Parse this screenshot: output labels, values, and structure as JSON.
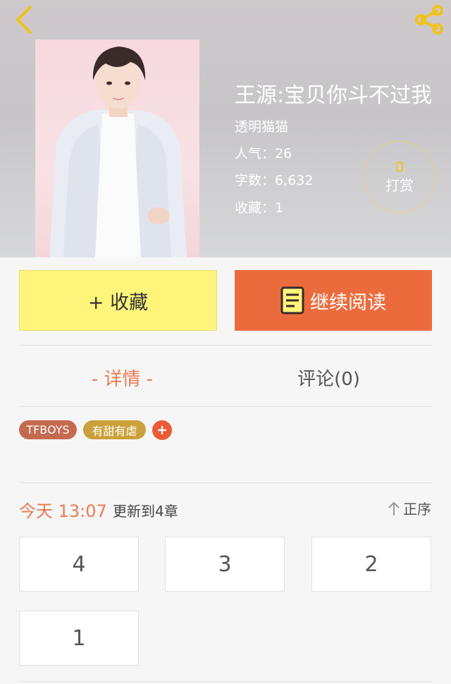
{
  "book": {
    "title": "王源:宝贝你斗不过我",
    "author": "透明猫猫",
    "popularity": "人气：26",
    "word_count": "字数：6,632",
    "favorites": "收藏：1",
    "reward_count": "0",
    "reward_label": "打赏"
  },
  "actions": {
    "favorite_label": "+ 收藏",
    "read_label": "继续阅读"
  },
  "tabs": [
    {
      "label": "- 详情 -",
      "active": true
    },
    {
      "label": "评论(0)",
      "active": false
    }
  ],
  "tags": [
    "TFBOYS",
    "有甜有虐"
  ],
  "update": {
    "time": "今天 13:07",
    "text": "更新到4章",
    "sort_label": "正序"
  },
  "chapters": [
    "4",
    "3",
    "2",
    "1"
  ],
  "colors": {
    "accent": "#ec6b3d",
    "favorite_button": "#fff57a",
    "tag_tfboys": "#c46a4f",
    "tag_sweet": "#caa13a",
    "reward_count": "#f0c419"
  },
  "icons": {
    "back": "chevron-left-icon",
    "share": "share-icon",
    "book": "book-icon",
    "sort": "arrow-up-icon",
    "add_tag": "plus-icon"
  }
}
